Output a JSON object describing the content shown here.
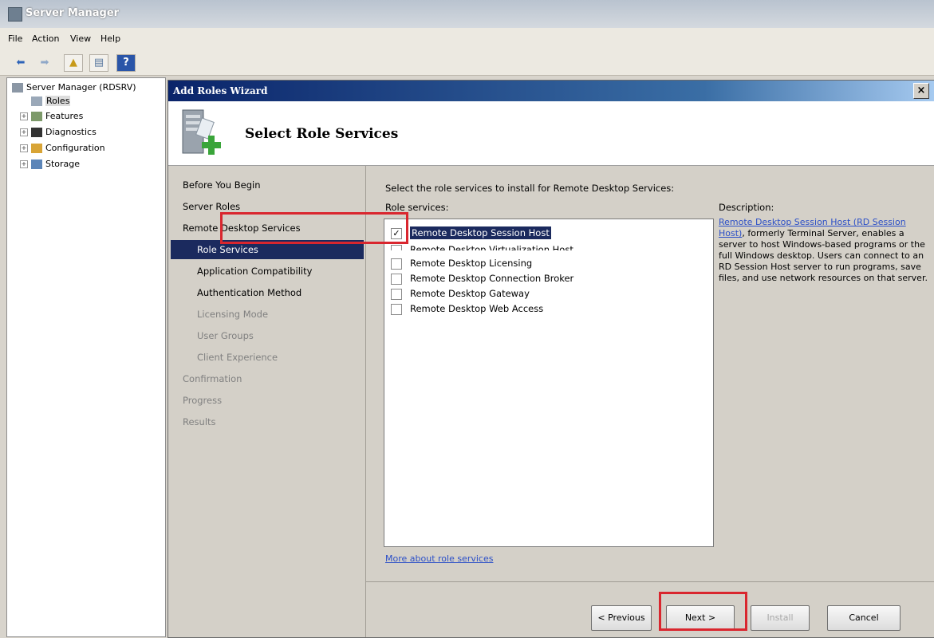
{
  "window": {
    "title": "Server Manager"
  },
  "menu": [
    "File",
    "Action",
    "View",
    "Help"
  ],
  "tree": {
    "root": "Server Manager (RDSRV)",
    "items": [
      "Roles",
      "Features",
      "Diagnostics",
      "Configuration",
      "Storage"
    ]
  },
  "wizard": {
    "title": "Add Roles Wizard",
    "close": "×",
    "header_title": "Select Role Services",
    "steps": [
      {
        "label": "Before You Begin"
      },
      {
        "label": "Server Roles"
      },
      {
        "label": "Remote Desktop Services"
      },
      {
        "label": "Role Services"
      },
      {
        "label": "Application Compatibility"
      },
      {
        "label": "Authentication Method"
      },
      {
        "label": "Licensing Mode"
      },
      {
        "label": "User Groups"
      },
      {
        "label": "Client Experience"
      },
      {
        "label": "Confirmation"
      },
      {
        "label": "Progress"
      },
      {
        "label": "Results"
      }
    ],
    "instruction": "Select the role services to install for Remote Desktop Services:",
    "role_services_label": "Role services:",
    "role_services": [
      {
        "label": "Remote Desktop Session Host",
        "checked": true
      },
      {
        "label": "Remote Desktop Virtualization Host",
        "checked": false
      },
      {
        "label": "Remote Desktop Licensing",
        "checked": false
      },
      {
        "label": "Remote Desktop Connection Broker",
        "checked": false
      },
      {
        "label": "Remote Desktop Gateway",
        "checked": false
      },
      {
        "label": "Remote Desktop Web Access",
        "checked": false
      }
    ],
    "description_label": "Description:",
    "description_link": "Remote Desktop Session Host (RD Session Host)",
    "description_text": ", formerly Terminal Server, enables a server to host Windows-based programs or the full Windows desktop. Users can connect to an RD Session Host server to run programs, save files, and use network resources on that server.",
    "more_link": "More about role services",
    "buttons": {
      "previous": "< Previous",
      "next": "Next >",
      "install": "Install",
      "cancel": "Cancel"
    }
  },
  "colors": {
    "highlight": "#d9262e",
    "selection": "#1b2a5e",
    "link": "#2b4fc7"
  }
}
